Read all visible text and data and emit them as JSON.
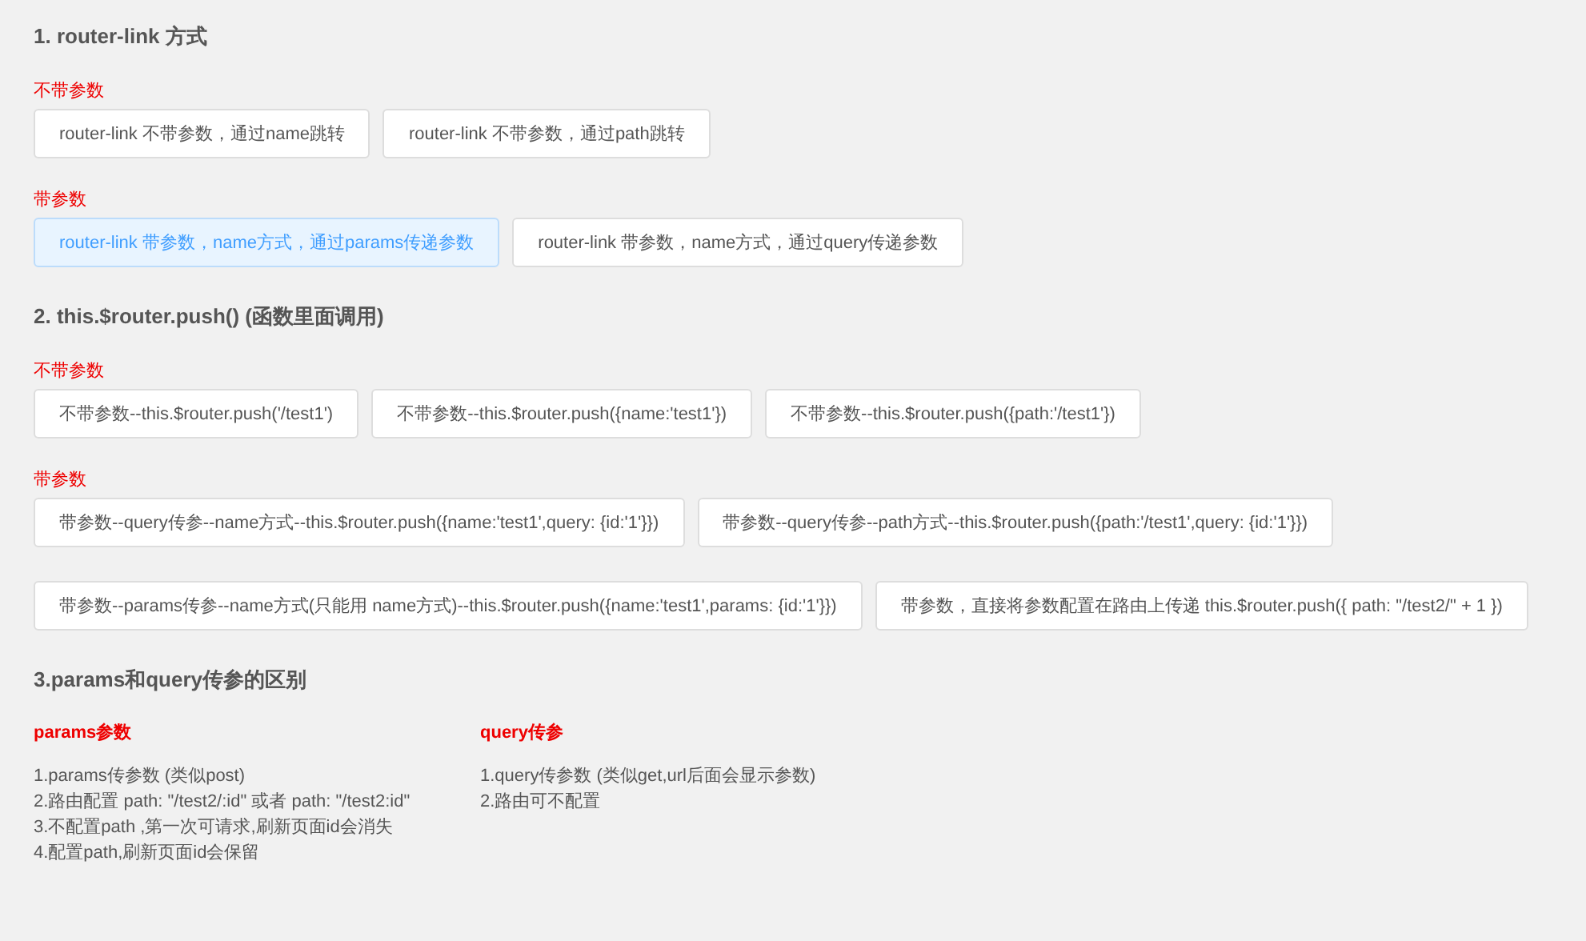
{
  "sections": [
    {
      "title": "1. router-link 方式",
      "groups": [
        {
          "label": "不带参数",
          "rows": [
            [
              {
                "text": "router-link 不带参数，通过name跳转",
                "selected": false
              },
              {
                "text": "router-link 不带参数，通过path跳转",
                "selected": false
              }
            ]
          ]
        },
        {
          "label": "带参数",
          "rows": [
            [
              {
                "text": "router-link 带参数，name方式，通过params传递参数",
                "selected": true
              },
              {
                "text": "router-link 带参数，name方式，通过query传递参数",
                "selected": false
              }
            ]
          ]
        }
      ]
    },
    {
      "title": "2. this.$router.push() (函数里面调用)",
      "groups": [
        {
          "label": "不带参数",
          "rows": [
            [
              {
                "text": "不带参数--this.$router.push('/test1')",
                "selected": false
              },
              {
                "text": "不带参数--this.$router.push({name:'test1'})",
                "selected": false
              },
              {
                "text": "不带参数--this.$router.push({path:'/test1'})",
                "selected": false
              }
            ]
          ]
        },
        {
          "label": "带参数",
          "rows": [
            [
              {
                "text": "带参数--query传参--name方式--this.$router.push({name:'test1',query: {id:'1'}})",
                "selected": false
              },
              {
                "text": "带参数--query传参--path方式--this.$router.push({path:'/test1',query: {id:'1'}})",
                "selected": false
              }
            ],
            [
              {
                "text": "带参数--params传参--name方式(只能用 name方式)--this.$router.push({name:'test1',params: {id:'1'}})",
                "selected": false
              },
              {
                "text": "带参数，直接将参数配置在路由上传递 this.$router.push({ path: \"/test2/\" + 1 })",
                "selected": false
              }
            ]
          ]
        }
      ]
    }
  ],
  "comparison": {
    "title": "3.params和query传参的区别",
    "columns": [
      {
        "title": "params参数",
        "lines": [
          "1.params传参数 (类似post)",
          "2.路由配置 path: \"/test2/:id\" 或者 path: \"/test2:id\"",
          "3.不配置path ,第一次可请求,刷新页面id会消失",
          "4.配置path,刷新页面id会保留"
        ]
      },
      {
        "title": "query传参",
        "lines": [
          "1.query传参数 (类似get,url后面会显示参数)",
          "2.路由可不配置"
        ]
      }
    ]
  }
}
